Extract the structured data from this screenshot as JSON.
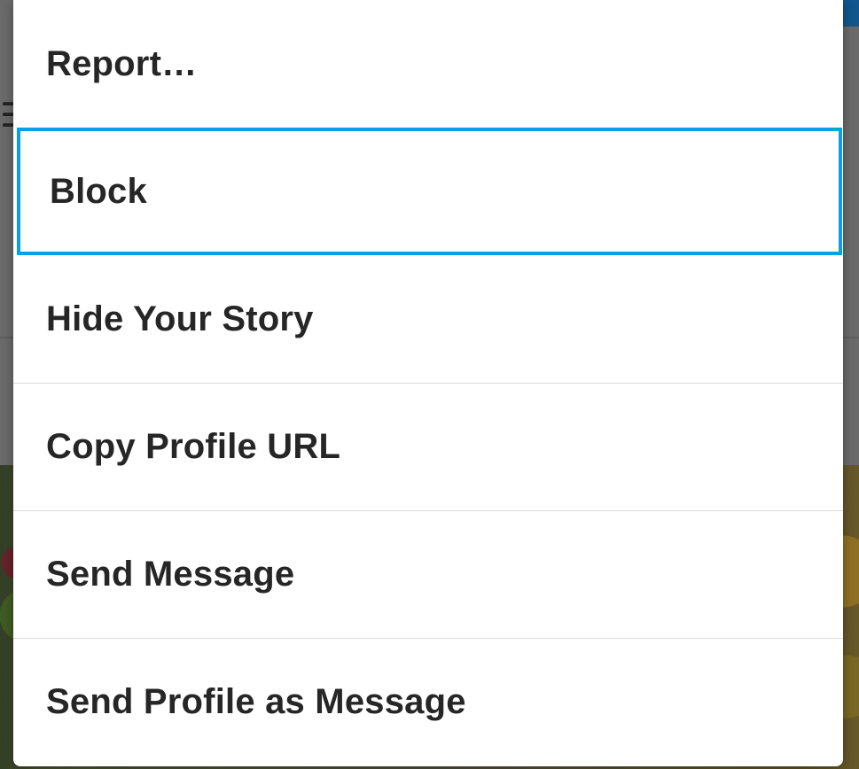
{
  "menu": {
    "items": [
      {
        "label": "Report…"
      },
      {
        "label": "Block"
      },
      {
        "label": "Hide Your Story"
      },
      {
        "label": "Copy Profile URL"
      },
      {
        "label": "Send Message"
      },
      {
        "label": "Send Profile as Message"
      }
    ],
    "focused_index": 1
  },
  "colors": {
    "dialog_background": "#ffffff",
    "text": "#262626",
    "focus_ring": "#0aa0e0",
    "separator": "#dbdbdb"
  }
}
